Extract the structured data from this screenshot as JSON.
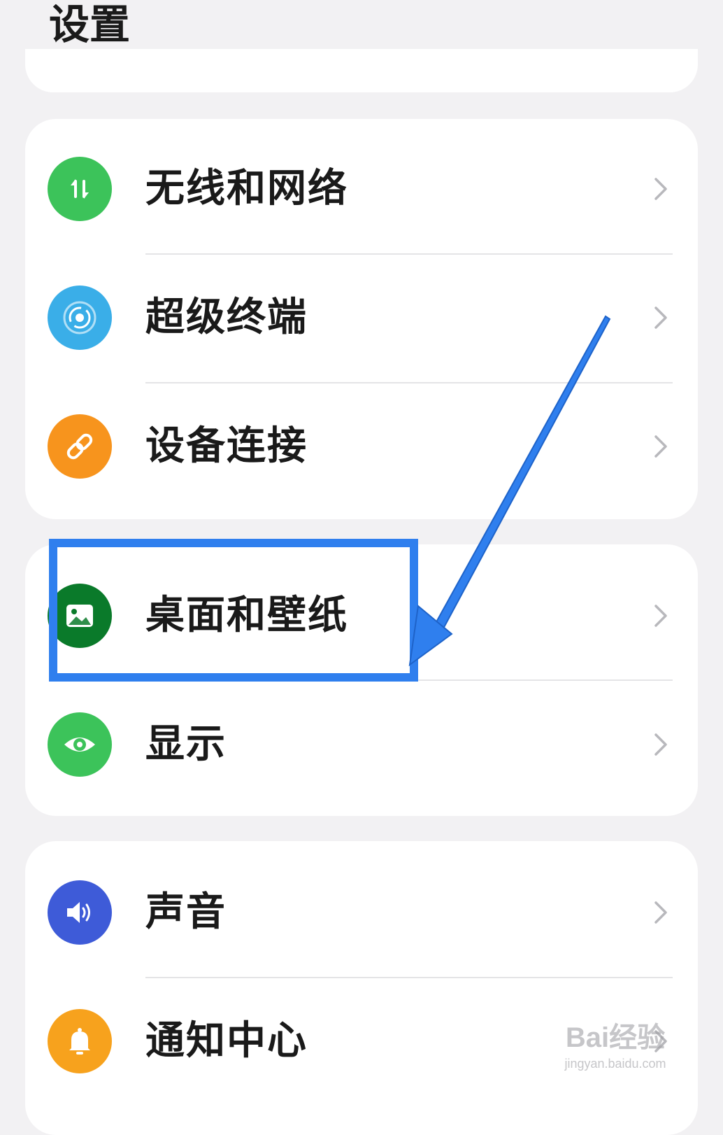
{
  "header": {
    "title": "设置"
  },
  "groups": [
    {
      "items": [
        {
          "label": "无线和网络",
          "icon": "wireless-network-icon",
          "color": "#3cc35a"
        },
        {
          "label": "超级终端",
          "icon": "super-device-icon",
          "color": "#3aaee8"
        },
        {
          "label": "设备连接",
          "icon": "link-icon",
          "color": "#f7941d"
        }
      ]
    },
    {
      "items": [
        {
          "label": "桌面和壁纸",
          "icon": "wallpaper-icon",
          "color": "#0a7a2a"
        },
        {
          "label": "显示",
          "icon": "eye-icon",
          "color": "#3cc35a"
        }
      ]
    },
    {
      "items": [
        {
          "label": "声音",
          "icon": "speaker-icon",
          "color": "#3e5bd8"
        },
        {
          "label": "通知中心",
          "icon": "bell-icon",
          "color": "#f7a21d"
        }
      ]
    }
  ],
  "annotation": {
    "color": "#2f7fee"
  },
  "watermark": {
    "main": "Bai经验",
    "sub": "jingyan.baidu.com"
  }
}
